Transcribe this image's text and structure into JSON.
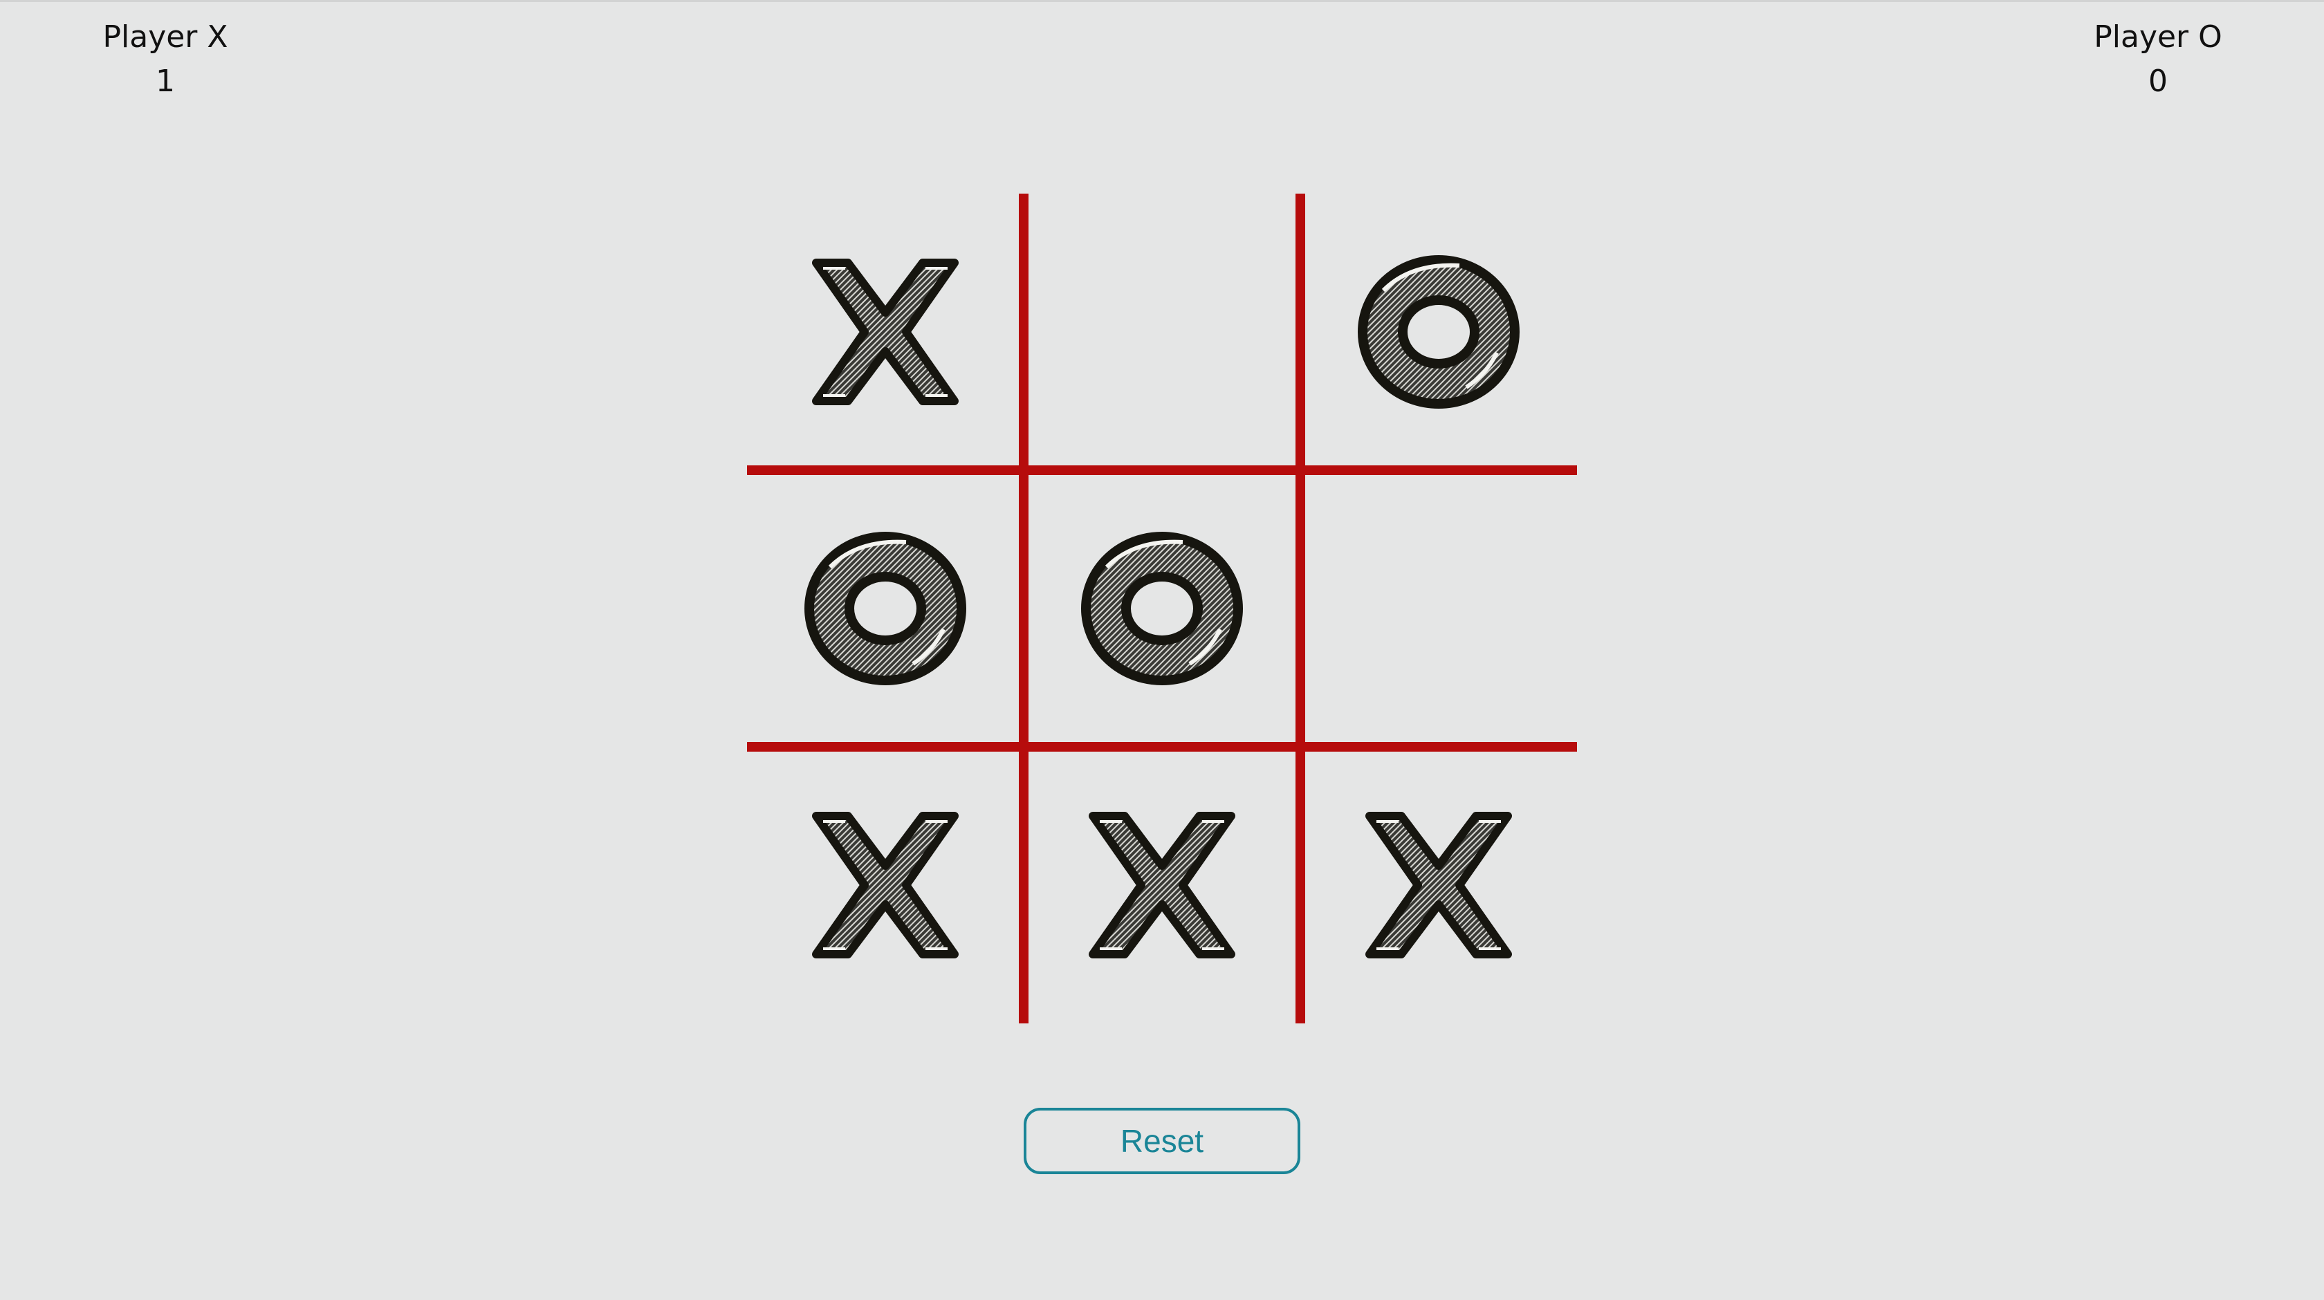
{
  "scoreboard": {
    "player_x": {
      "name": "Player X",
      "score": "1"
    },
    "player_o": {
      "name": "Player O",
      "score": "0"
    }
  },
  "board": {
    "cells": [
      "X",
      "",
      "O",
      "O",
      "O",
      "",
      "X",
      "X",
      "X"
    ],
    "line_color": "#b60c0c",
    "mark_color": "#16150f"
  },
  "controls": {
    "reset_label": "Reset",
    "accent_color": "#1a8597"
  }
}
